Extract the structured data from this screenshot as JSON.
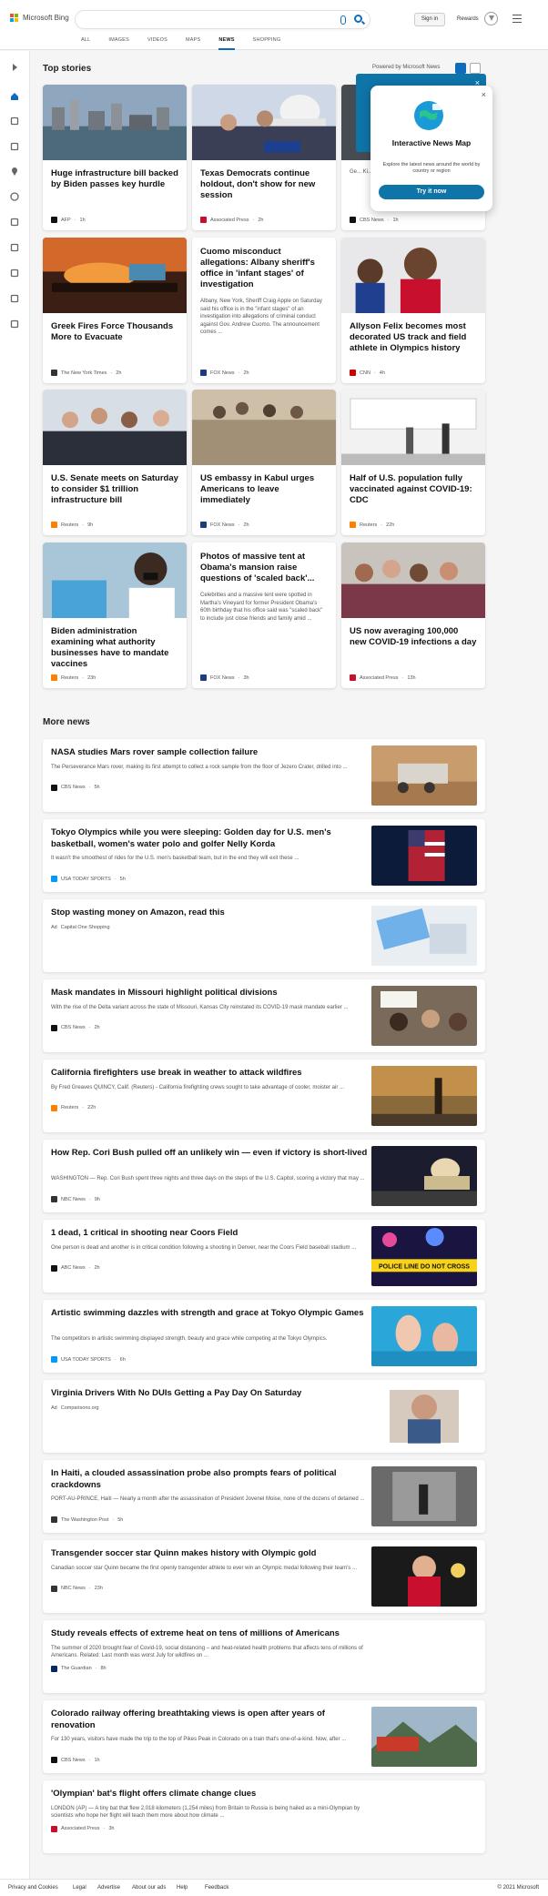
{
  "header": {
    "logo_text": "Microsoft Bing",
    "signin": "Sign in",
    "rewards": "Rewards",
    "search_placeholder": "",
    "tabs": [
      "ALL",
      "IMAGES",
      "VIDEOS",
      "MAPS",
      "NEWS",
      "SHOPPING"
    ],
    "active_tab": "NEWS"
  },
  "colors": {
    "accent": "#0f6cbd",
    "popup_blue": "#0f74a8"
  },
  "rail_icons": [
    "chevron-right-icon",
    "home-icon",
    "arrows-icon",
    "flag-icon",
    "location-pin-icon",
    "globe-icon",
    "ruler-icon",
    "rocket-icon",
    "science-icon",
    "building-icon",
    "card-icon"
  ],
  "top_stories": {
    "title": "Top stories",
    "powered": "Powered by Microsoft News",
    "cards": [
      {
        "title": "Huge infrastructure bill backed by Biden passes key hurdle",
        "summary": "",
        "source": "AFP",
        "age": "1h",
        "src_color": "#111",
        "img": "city"
      },
      {
        "title": "Texas Democrats continue holdout, don't show for new session",
        "summary": "",
        "source": "Associated Press",
        "age": "2h",
        "src_color": "#c8102e",
        "img": "capitol"
      },
      {
        "title": "",
        "summary": "Ge... Ki... re... was e... horse",
        "source": "CBS News",
        "age": "1h",
        "src_color": "#111",
        "img": "dark"
      },
      {
        "title": "Greek Fires Force Thousands More to Evacuate",
        "summary": "",
        "source": "The New York Times",
        "age": "2h",
        "src_color": "#333",
        "img": "fire"
      },
      {
        "title": "Cuomo misconduct allegations: Albany sheriff's office in 'infant stages' of investigation",
        "summary": "Albany, New York, Sheriff Craig Apple on Saturday said his office is in the \"infant stages\" of an investigation into allegations of criminal conduct against Gov. Andrew Cuomo. The announcement comes ...",
        "source": "FOX News",
        "age": "2h",
        "src_color": "#1c3c7e",
        "img": "none"
      },
      {
        "title": "Allyson Felix becomes most decorated US track and field athlete in Olympics history",
        "summary": "",
        "source": "CNN",
        "age": "4h",
        "src_color": "#cc0000",
        "img": "athlete"
      },
      {
        "title": "U.S. Senate meets on Saturday to consider $1 trillion infrastructure bill",
        "summary": "",
        "source": "Reuters",
        "age": "9h",
        "src_color": "#ff8000",
        "img": "senate"
      },
      {
        "title": "US embassy in Kabul urges Americans to leave immediately",
        "summary": "",
        "source": "FOX News",
        "age": "2h",
        "src_color": "#1c3c7e",
        "img": "kabul"
      },
      {
        "title": "Half of U.S. population fully vaccinated against COVID-19: CDC",
        "summary": "",
        "source": "Reuters",
        "age": "22h",
        "src_color": "#ff8000",
        "img": "clinic"
      },
      {
        "title": "Biden administration examining what authority businesses have to mandate vaccines",
        "summary": "",
        "source": "Reuters",
        "age": "23h",
        "src_color": "#ff8000",
        "img": "vaccine"
      },
      {
        "title": "Photos of massive tent at Obama's mansion raise questions of 'scaled back'...",
        "summary": "Celebrities and a massive tent were spotted in Martha's Vineyard for former President Obama's 60th birthday that his office said was \"scaled back\" to include just close friends and family amid ...",
        "source": "FOX News",
        "age": "3h",
        "src_color": "#1c3c7e",
        "img": "none"
      },
      {
        "title": "US now averaging 100,000 new COVID-19 infections a day",
        "summary": "",
        "source": "Associated Press",
        "age": "13h",
        "src_color": "#c8102e",
        "img": "crowd"
      }
    ]
  },
  "popup": {
    "title": "Interactive News Map",
    "text": "Explore the latest news around the world by country or region",
    "button": "Try it now",
    "close": "×"
  },
  "more_news": {
    "title": "More news",
    "items": [
      {
        "title": "NASA studies Mars rover sample collection failure",
        "summary": "The Perseverance Mars rover, making its first attempt to collect a rock sample from the floor of Jezero Crater, drilled into ...",
        "source": "CBS News",
        "age": "5h",
        "src_color": "#111",
        "img": "mars"
      },
      {
        "title": "Tokyo Olympics while you were sleeping: Golden day for U.S. men's basketball, women's water polo and golfer Nelly Korda",
        "summary": "It wasn't the smoothest of rides for the U.S. men's basketball team, but in the end they will exit these ...",
        "source": "USA TODAY SPORTS",
        "age": "5h",
        "src_color": "#009bff",
        "img": "flag"
      },
      {
        "title": "Stop wasting money on Amazon, read this",
        "summary": "",
        "source": "Capital One Shopping",
        "age": "",
        "ad": "Ad",
        "src_color": "",
        "img": "coupon"
      },
      {
        "title": "Mask mandates in Missouri highlight political divisions",
        "summary": "With the rise of the Delta variant across the state of Missouri, Kansas City reinstated its COVID-19 mask mandate earlier ...",
        "source": "CBS News",
        "age": "2h",
        "src_color": "#111",
        "img": "protest"
      },
      {
        "title": "California firefighters use break in weather to attack wildfires",
        "summary": "By Fred Greaves QUINCY, Calif. (Reuters) - California firefighting crews sought to take advantage of cooler, moister air ...",
        "source": "Reuters",
        "age": "22h",
        "src_color": "#ff8000",
        "img": "wildfire"
      },
      {
        "title": "How Rep. Cori Bush pulled off an unlikely win — even if victory is short-lived",
        "summary": "WASHINGTON — Rep. Cori Bush spent three nights and three days on the steps of the U.S. Capitol, scoring a victory that may ...",
        "source": "NBC News",
        "age": "9h",
        "src_color": "#333",
        "img": "capitolnight"
      },
      {
        "title": "1 dead, 1 critical in shooting near Coors Field",
        "summary": "One person is dead and another is in critical condition following a shooting in Denver, near the Coors Field baseball stadium ...",
        "source": "ABC News",
        "age": "2h",
        "src_color": "#111",
        "img": "police",
        "police_text": "POLICE LINE DO NOT CROSS"
      },
      {
        "title": "Artistic swimming dazzles with strength and grace at Tokyo Olympic Games",
        "summary": "The competitors in artistic swimming displayed strength, beauty and grace while competing at the Tokyo Olympics.",
        "source": "USA TODAY SPORTS",
        "age": "6h",
        "src_color": "#009bff",
        "img": "swim"
      },
      {
        "title": "Virginia Drivers With No DUIs Getting a Pay Day On Saturday",
        "summary": "",
        "source": "Comparisons.org",
        "age": "",
        "ad": "Ad",
        "src_color": "",
        "img": "man"
      },
      {
        "title": "In Haiti, a clouded assassination probe also prompts fears of political crackdowns",
        "summary": "PORT-AU-PRINCE, Haiti — Nearly a month after the assassination of President Jovenel Moise, none of the dozens of detained ...",
        "source": "The Washington Post",
        "age": "5h",
        "src_color": "#333",
        "img": "hall"
      },
      {
        "title": "Transgender soccer star Quinn makes history with Olympic gold",
        "summary": "Canadian soccer star Quinn became the first openly transgender athlete to ever win an Olympic medal following their team's ...",
        "source": "NBC News",
        "age": "23h",
        "src_color": "#333",
        "img": "soccer"
      },
      {
        "title": "Study reveals effects of extreme heat on tens of millions of Americans",
        "summary": "The summer of 2020 brought fear of Covid-19, social distancing – and heat-related health problems that affects tens of millions of Americans. Related: Last month was worst July for wildfires on ...",
        "source": "The Guardian",
        "age": "8h",
        "src_color": "#052962",
        "img": ""
      },
      {
        "title": "Colorado railway offering breathtaking views is open after years of renovation",
        "summary": "For 130 years, visitors have made the trip to the top of Pikes Peak in Colorado on a train that's one-of-a-kind. Now, after ...",
        "source": "CBS News",
        "age": "1h",
        "src_color": "#111",
        "img": "mountain"
      },
      {
        "title": "'Olympian' bat's flight offers climate change clues",
        "summary": "LONDON (AP) — A tiny bat that flew 2,018 kilometers (1,254 miles) from Britain to Russia is being hailed as a mini-Olympian by scientists who hope her flight will teach them more about how climate ...",
        "source": "Associated Press",
        "age": "3h",
        "src_color": "#c8102e",
        "img": ""
      }
    ]
  },
  "footer": {
    "links": [
      "Privacy and Cookies",
      "Legal",
      "Advertise",
      "About our ads",
      "Help",
      "Feedback"
    ],
    "copyright": "© 2021 Microsoft"
  }
}
